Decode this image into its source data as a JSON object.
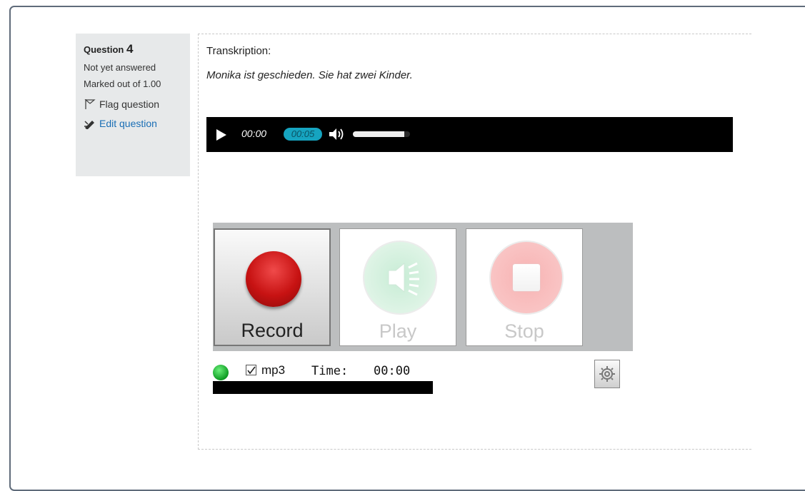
{
  "question_info": {
    "question_prefix": "Question",
    "question_number": "4",
    "state": "Not yet answered",
    "grade": "Marked out of 1.00",
    "flag_label": "Flag question",
    "edit_label": "Edit question"
  },
  "question": {
    "transcription_label": "Transkription:",
    "transcription_text": "Monika ist geschieden. Sie hat zwei Kinder."
  },
  "audio_player": {
    "current_time": "00:00",
    "duration": "00:05",
    "volume_level": 0.9,
    "icons": [
      "play-icon",
      "volume-icon"
    ]
  },
  "recorder": {
    "record_label": "Record",
    "play_label": "Play",
    "stop_label": "Stop",
    "format_label": "mp3",
    "format_checked": true,
    "time_label": "Time:",
    "time_value": "00:00",
    "status_color": "#0d9b22",
    "icons": [
      "record-icon",
      "speaker-icon",
      "stop-icon",
      "gear-icon"
    ]
  },
  "colors": {
    "accent_link": "#1a6eb5",
    "player_bg": "#000000",
    "progress_pill": "#16a4c0"
  }
}
